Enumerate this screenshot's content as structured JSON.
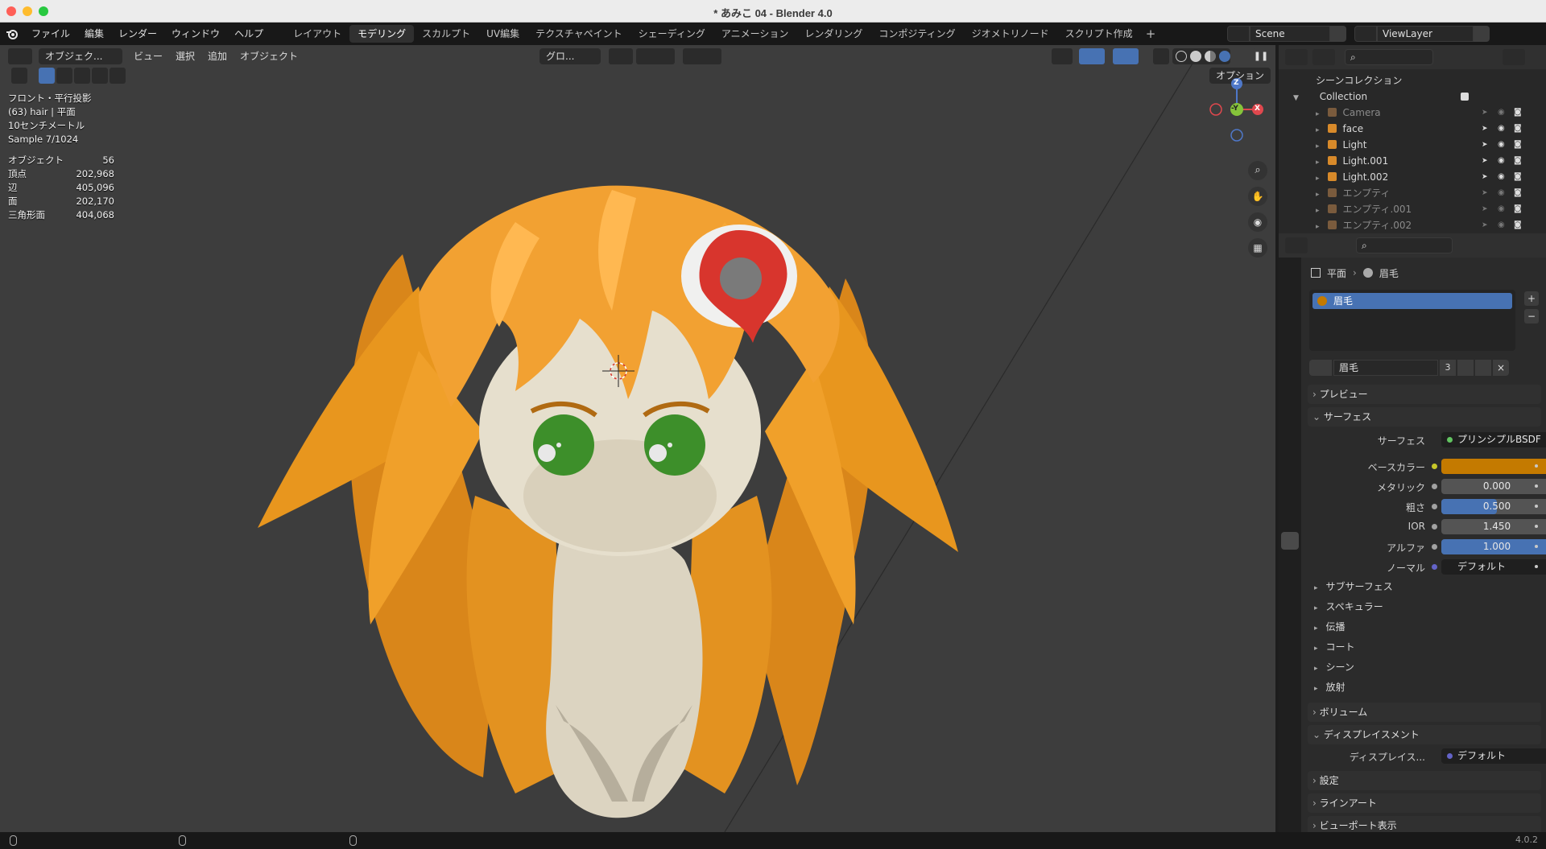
{
  "window": {
    "title": "* あみこ 04 - Blender 4.0"
  },
  "menu": [
    "ファイル",
    "編集",
    "レンダー",
    "ウィンドウ",
    "ヘルプ"
  ],
  "workspaces": [
    "レイアウト",
    "モデリング",
    "スカルプト",
    "UV編集",
    "テクスチャペイント",
    "シェーディング",
    "アニメーション",
    "レンダリング",
    "コンポジティング",
    "ジオメトリノード",
    "スクリプト作成"
  ],
  "active_workspace": "モデリング",
  "scene": {
    "name": "Scene",
    "view_layer": "ViewLayer"
  },
  "viewport": {
    "mode": "オブジェク...",
    "menus": [
      "ビュー",
      "選択",
      "追加",
      "オブジェクト"
    ],
    "orientation": "グロ...",
    "options_label": "オプション",
    "overlay": {
      "view": "フロント・平行投影",
      "object": "(63) hair | 平面",
      "scale": "10センチメートル",
      "sample": "Sample 7/1024"
    },
    "stats": [
      {
        "label": "オブジェクト",
        "value": "56"
      },
      {
        "label": "頂点",
        "value": "202,968"
      },
      {
        "label": "辺",
        "value": "405,096"
      },
      {
        "label": "面",
        "value": "202,170"
      },
      {
        "label": "三角形面",
        "value": "404,068"
      }
    ],
    "gizmo": {
      "z": "Z",
      "y": "-Y",
      "x": "X"
    }
  },
  "outliner": {
    "root": "シーンコレクション",
    "collection": "Collection",
    "items": [
      {
        "name": "Camera",
        "dim": true
      },
      {
        "name": "face",
        "dim": false
      },
      {
        "name": "Light",
        "dim": false
      },
      {
        "name": "Light.001",
        "dim": false
      },
      {
        "name": "Light.002",
        "dim": false
      },
      {
        "name": "エンプティ",
        "dim": true
      },
      {
        "name": "エンプティ.001",
        "dim": true
      },
      {
        "name": "エンプティ.002",
        "dim": true
      }
    ]
  },
  "properties": {
    "breadcrumb": [
      "平面",
      "眉毛"
    ],
    "slot": "眉毛",
    "material_name": "眉毛",
    "users": "3",
    "sections": {
      "preview": "プレビュー",
      "surface": "サーフェス",
      "volume": "ボリューム",
      "displacement": "ディスプレイスメント",
      "settings": "設定",
      "lineart": "ラインアート",
      "viewport_display": "ビューポート表示"
    },
    "surface_label": "サーフェス",
    "surface_shader": "プリンシプルBSDF",
    "fields": [
      {
        "label": "ベースカラー",
        "value": "",
        "kind": "color",
        "color": "#c47a00"
      },
      {
        "label": "メタリック",
        "value": "0.000",
        "kind": "number",
        "fill": 0.0
      },
      {
        "label": "粗さ",
        "value": "0.500",
        "kind": "number",
        "fill": 0.5
      },
      {
        "label": "IOR",
        "value": "1.450",
        "kind": "number",
        "fill": 0.0
      },
      {
        "label": "アルファ",
        "value": "1.000",
        "kind": "number",
        "fill": 1.0
      },
      {
        "label": "ノーマル",
        "value": "デフォルト",
        "kind": "link"
      }
    ],
    "subpanels": [
      "サブサーフェス",
      "スペキュラー",
      "伝播",
      "コート",
      "シーン",
      "放射"
    ],
    "displacement_label": "ディスプレイス...",
    "displacement_value": "デフォルト"
  },
  "status": {
    "version": "4.0.2"
  },
  "colors": {
    "accent": "#4772b3",
    "hair": "#e8961e",
    "eyes": "#3d8f2a"
  }
}
